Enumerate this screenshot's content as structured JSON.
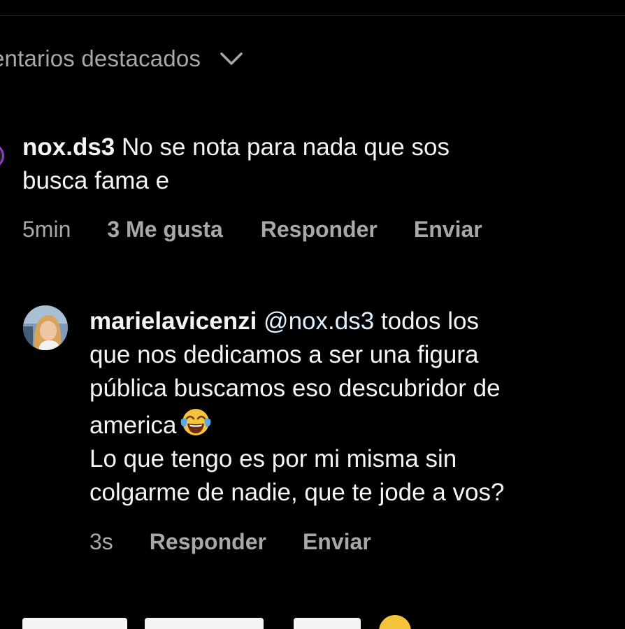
{
  "sort": {
    "label": "entarios destacados",
    "icon": "chevron-down-icon"
  },
  "comment": {
    "username": "nox.ds3",
    "text_line1": "No se nota para nada que sos",
    "text_line2": "busca fama e",
    "time": "5min",
    "likes": "3 Me gusta",
    "reply_label": "Responder",
    "send_label": "Enviar"
  },
  "reply": {
    "username": "marielavicenzi",
    "mention": "@nox.ds3",
    "text_line1": "todos los",
    "text_line2": "que nos dedicamos a ser una figura",
    "text_line3": "pública buscamos eso descubridor de",
    "text_line4": "america",
    "emoji": "face-with-tears-of-joy",
    "text_line5": "Lo que tengo es por mi misma sin",
    "text_line6": "colgarme de nadie, que te jode a vos?",
    "time": "3s",
    "reply_label": "Responder",
    "send_label": "Enviar"
  },
  "colors": {
    "background": "#000000",
    "primary_text": "#f5f5f5",
    "secondary_text": "#a8a8a8",
    "mention": "#e0f1ff",
    "story_ring": "#8e3bd2"
  }
}
